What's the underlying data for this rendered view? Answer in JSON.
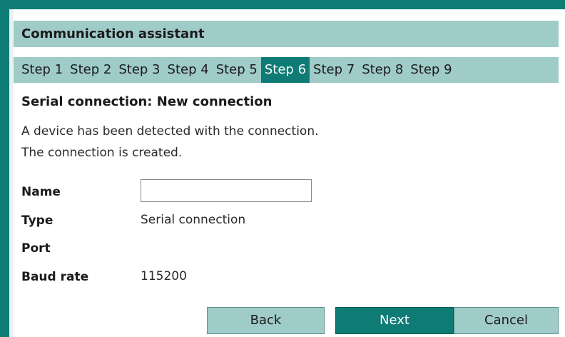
{
  "window": {
    "title": "Communication assistant"
  },
  "steps": [
    "Step 1",
    "Step 2",
    "Step 3",
    "Step 4",
    "Step 5",
    "Step 6",
    "Step 7",
    "Step 8",
    "Step 9"
  ],
  "active_step": "Step 6",
  "section": {
    "heading": "Serial connection: New connection",
    "description_line1": "A device has been detected with the connection.",
    "description_line2": "The connection is created."
  },
  "fields": {
    "name_label": "Name",
    "name_value": "",
    "type_label": "Type",
    "type_value": "Serial connection",
    "port_label": "Port",
    "port_value": "",
    "baud_label": "Baud rate",
    "baud_value": "115200"
  },
  "buttons": {
    "back": "Back",
    "next": "Next",
    "cancel": "Cancel"
  },
  "colors": {
    "teal_dark": "#0f7b75",
    "teal_light": "#9fcbc9"
  }
}
